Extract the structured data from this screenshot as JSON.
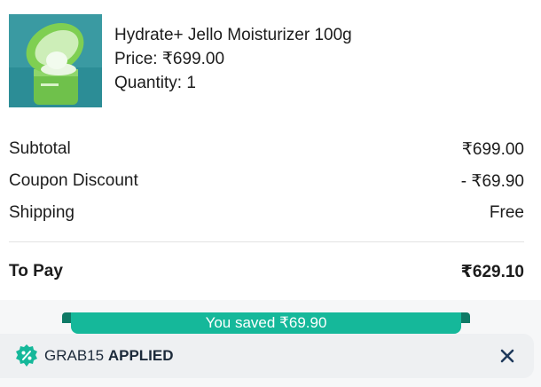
{
  "product": {
    "name": "Hydrate+ Jello Moisturizer 100g",
    "price": "Price: ₹699.00",
    "quantity": "Quantity: 1",
    "image_icon": "product-jar-image"
  },
  "summary": {
    "subtotal_label": "Subtotal",
    "subtotal_value": "₹699.00",
    "discount_label": "Coupon Discount",
    "discount_value": "- ₹69.90",
    "shipping_label": "Shipping",
    "shipping_value": "Free",
    "total_label": "To Pay",
    "total_value": "₹629.10"
  },
  "savings": {
    "text": "You saved ₹69.90",
    "color": "#15b89a"
  },
  "coupon": {
    "code": "GRAB15",
    "status": "APPLIED",
    "icon": "discount-badge-icon",
    "close_icon": "close-icon",
    "accent": "#15b89a"
  }
}
